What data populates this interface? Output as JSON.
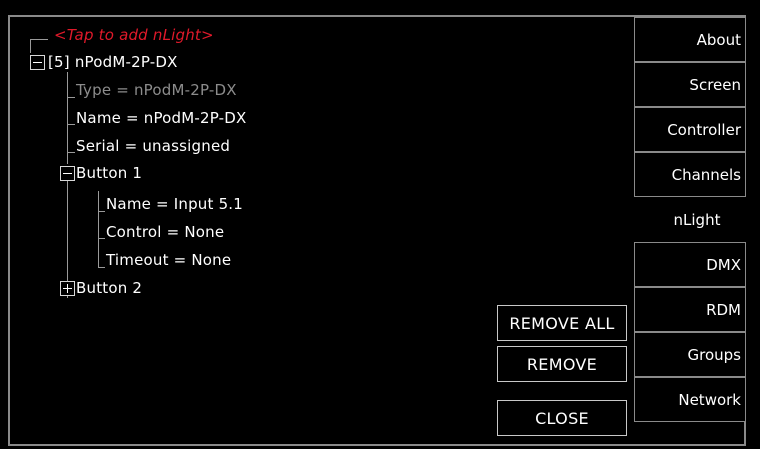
{
  "tree": {
    "add_prompt": "<Tap to add nLight>",
    "device": "[5] nPodM-2P-DX",
    "type": "Type = nPodM-2P-DX",
    "name": "Name = nPodM-2P-DX",
    "serial": "Serial = unassigned",
    "button1": {
      "label": "Button 1",
      "name": "Name = Input 5.1",
      "control": "Control = None",
      "timeout": "Timeout = None"
    },
    "button2": {
      "label": "Button 2"
    }
  },
  "actions": {
    "remove_all": "REMOVE ALL",
    "remove": "REMOVE",
    "close": "CLOSE"
  },
  "tabs": {
    "about": "About",
    "screen": "Screen",
    "controller": "Controller",
    "channels": "Channels",
    "nlight": "nLight",
    "dmx": "DMX",
    "rdm": "RDM",
    "groups": "Groups",
    "network": "Network",
    "active": "nLight"
  },
  "colors": {
    "accent_red": "#e0192a",
    "dim_text": "#8c8c8c",
    "border": "#8a8a8a"
  }
}
